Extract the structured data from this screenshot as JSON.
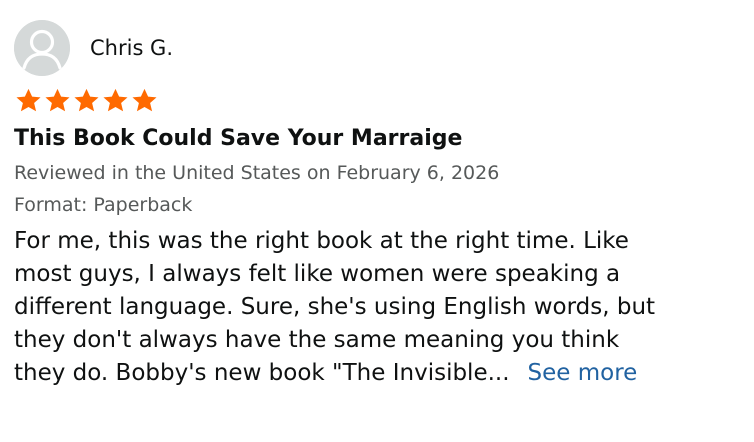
{
  "review": {
    "profile_name": "Chris G.",
    "rating": 5,
    "rating_max": 5,
    "star_color": "#ff6a00",
    "title": "This Book Could Save Your Marraige",
    "date_text": "Reviewed in the United States on February 6, 2026",
    "format_text": "Format: Paperback",
    "body_lines": [
      "For me, this was the right book at the right time. Like",
      "most guys, I always felt like women were speaking a",
      "different language. Sure, she's using English words, but",
      "they don't always have the same meaning you think",
      "they do. Bobby's new book \"The Invisible..."
    ],
    "see_more_label": "See more",
    "link_color": "#2162a1"
  }
}
